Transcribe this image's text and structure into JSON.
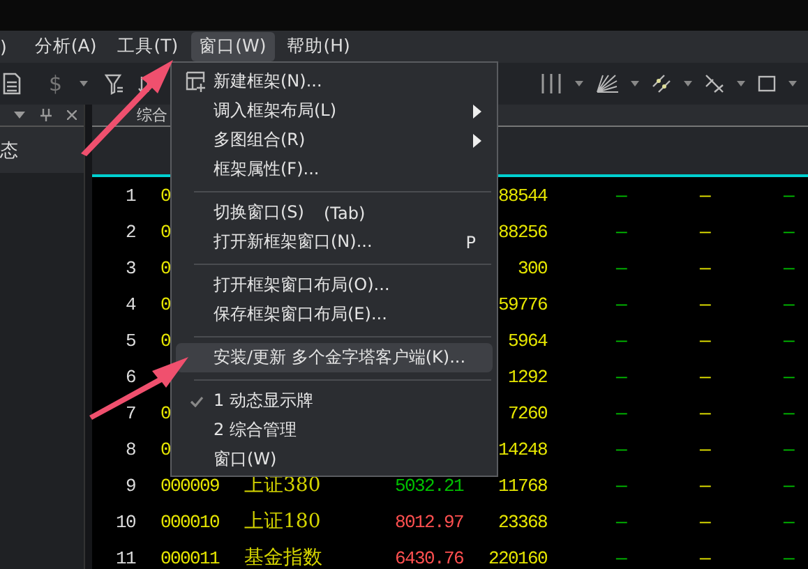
{
  "menubar": [
    {
      "label": ")",
      "selected": false
    },
    {
      "label": "分析(A)",
      "selected": false
    },
    {
      "label": "工具(T)",
      "selected": false
    },
    {
      "label": "窗口(W)",
      "selected": true
    },
    {
      "label": "帮助(H)",
      "selected": false
    }
  ],
  "toolbar": {
    "currency_symbol": "$"
  },
  "left_panel": {
    "title": "态"
  },
  "tab": {
    "label": "综合"
  },
  "table": {
    "rows": [
      {
        "index": "1",
        "code": "0",
        "volume": "88544",
        "column_6": "—",
        "column_7": "—",
        "column_8": "—"
      },
      {
        "index": "2",
        "code": "0",
        "volume": "88256",
        "column_6": "—",
        "column_7": "—",
        "column_8": "—"
      },
      {
        "index": "3",
        "code": "0",
        "volume": "300",
        "column_6": "—",
        "column_7": "—",
        "column_8": "—"
      },
      {
        "index": "4",
        "code": "0",
        "volume": "59776",
        "column_6": "—",
        "column_7": "—",
        "column_8": "—"
      },
      {
        "index": "5",
        "code": "0",
        "volume": "5964",
        "column_6": "—",
        "column_7": "—",
        "column_8": "—"
      },
      {
        "index": "6",
        "volume": "1292",
        "column_6": "—",
        "column_7": "—",
        "column_8": "—"
      },
      {
        "index": "7",
        "code": "0",
        "volume": "7260",
        "column_6": "—",
        "column_7": "—",
        "column_8": "—"
      },
      {
        "index": "8",
        "code": "0",
        "volume": "14248",
        "column_6": "—",
        "column_7": "—",
        "column_8": "—"
      },
      {
        "index": "9",
        "code": "000009",
        "name": "上证380",
        "price": "5032.21",
        "color": "#00c000",
        "volume": "11768",
        "column_6": "—",
        "column_7": "—",
        "column_8": "—"
      },
      {
        "index": "10",
        "code": "000010",
        "name": "上证180",
        "price": "8012.97",
        "color": "#ff5050",
        "volume": "23368",
        "column_6": "—",
        "column_7": "—",
        "column_8": "—"
      },
      {
        "index": "11",
        "code": "000011",
        "name": "基金指数",
        "price": "6430.76",
        "color": "#ff5050",
        "volume": "220160",
        "column_6": "—",
        "column_7": "—",
        "column_8": "—"
      }
    ]
  },
  "menu": {
    "items": [
      {
        "kind": "icon-item",
        "label": "新建框架(N)...",
        "submenu": false,
        "checked": false,
        "selected": false
      },
      {
        "kind": "item",
        "label": "调入框架布局(L)",
        "submenu": true,
        "checked": false,
        "selected": false
      },
      {
        "kind": "item",
        "label": "多图组合(R)",
        "submenu": true,
        "checked": false,
        "selected": false
      },
      {
        "kind": "item",
        "label": "框架属性(F)...",
        "submenu": false,
        "checked": false,
        "selected": false
      },
      {
        "kind": "separator"
      },
      {
        "kind": "item",
        "label": "切换窗口(S)",
        "note": "(Tab)",
        "submenu": false,
        "checked": false,
        "selected": false
      },
      {
        "kind": "item",
        "label": "打开新框架窗口(N)...",
        "shortcut": "P",
        "submenu": false,
        "checked": false,
        "selected": false
      },
      {
        "kind": "separator"
      },
      {
        "kind": "item",
        "label": "打开框架窗口布局(O)...",
        "submenu": false,
        "checked": false,
        "selected": false
      },
      {
        "kind": "item",
        "label": "保存框架窗口布局(E)...",
        "submenu": false,
        "checked": false,
        "selected": false
      },
      {
        "kind": "separator"
      },
      {
        "kind": "item",
        "label": "安装/更新 多个金字塔客户端(K)...",
        "submenu": false,
        "checked": false,
        "selected": true
      },
      {
        "kind": "separator"
      },
      {
        "kind": "item",
        "label": "1 动态显示牌",
        "submenu": false,
        "checked": true,
        "selected": false
      },
      {
        "kind": "item",
        "label": "2 综合管理",
        "submenu": false,
        "checked": false,
        "selected": false
      },
      {
        "kind": "item",
        "label": "窗口(W)",
        "submenu": false,
        "checked": false,
        "selected": false
      }
    ]
  }
}
